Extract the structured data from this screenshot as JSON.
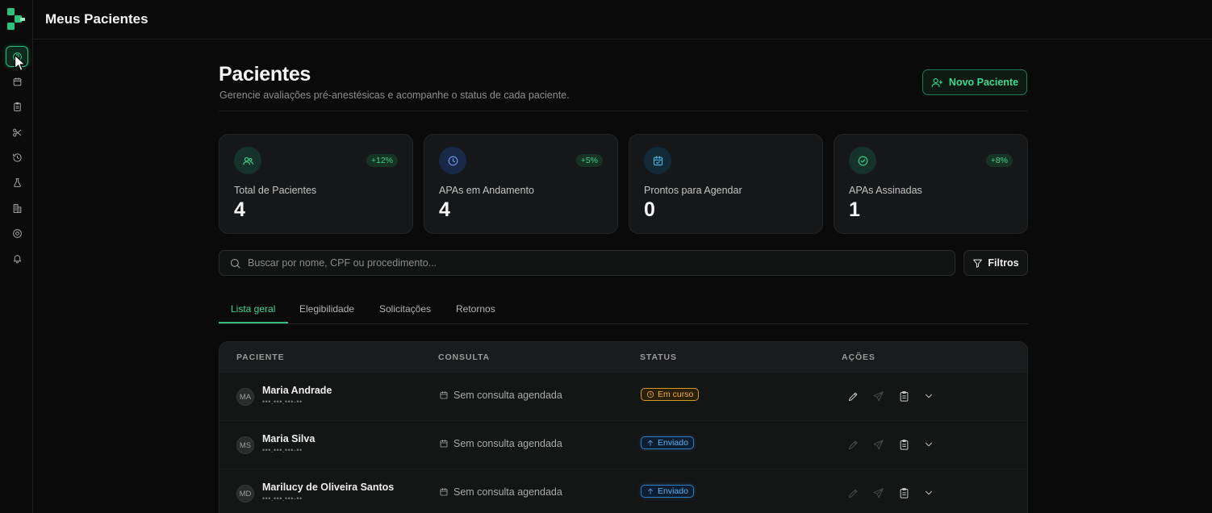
{
  "topbar": {
    "title": "Meus Pacientes"
  },
  "sidebar": {
    "items": [
      {
        "name": "patients",
        "icon": "user-circle-icon",
        "active": true
      },
      {
        "name": "calendar",
        "icon": "calendar-icon"
      },
      {
        "name": "clipboard",
        "icon": "clipboard-icon"
      },
      {
        "name": "procedures",
        "icon": "scissors-icon"
      },
      {
        "name": "history",
        "icon": "history-icon"
      },
      {
        "name": "lab",
        "icon": "flask-icon"
      },
      {
        "name": "buildings",
        "icon": "building-icon"
      },
      {
        "name": "profile",
        "icon": "at-sign-icon"
      },
      {
        "name": "notifications",
        "icon": "bell-icon"
      }
    ]
  },
  "header": {
    "title": "Pacientes",
    "subtitle": "Gerencie avaliações pré-anestésicas e acompanhe o status de cada paciente.",
    "new_button": "Novo Paciente"
  },
  "stats": [
    {
      "label": "Total de Pacientes",
      "value": "4",
      "badge": "+12%",
      "icon": "users-icon",
      "color": "#3fcf8a"
    },
    {
      "label": "APAs em Andamento",
      "value": "4",
      "badge": "+5%",
      "icon": "clock-icon",
      "color": "#5b8def"
    },
    {
      "label": "Prontos para Agendar",
      "value": "0",
      "badge": "",
      "icon": "calendar-check-icon",
      "color": "#4fb3e0"
    },
    {
      "label": "APAs Assinadas",
      "value": "1",
      "badge": "+8%",
      "icon": "check-circle-icon",
      "color": "#3fcf8a"
    }
  ],
  "search": {
    "placeholder": "Buscar por nome, CPF ou procedimento...",
    "value": ""
  },
  "filters_button": "Filtros",
  "tabs": [
    {
      "label": "Lista geral",
      "active": true
    },
    {
      "label": "Elegibilidade"
    },
    {
      "label": "Solicitações"
    },
    {
      "label": "Retornos"
    }
  ],
  "table": {
    "columns": [
      "PACIENTE",
      "CONSULTA",
      "STATUS",
      "AÇÕES"
    ],
    "rows": [
      {
        "initials": "MA",
        "name": "Maria Andrade",
        "doc": "•••.•••.•••-••",
        "consulta": "Sem consulta agendada",
        "status": "Em curso",
        "status_type": "curso",
        "edit_enabled": true
      },
      {
        "initials": "MS",
        "name": "Maria Silva",
        "doc": "•••.•••.•••-••",
        "consulta": "Sem consulta agendada",
        "status": "Enviado",
        "status_type": "enviado",
        "edit_enabled": false
      },
      {
        "initials": "MD",
        "name": "Marilucy de Oliveira Santos",
        "doc": "•••.•••.•••-••",
        "consulta": "Sem consulta agendada",
        "status": "Enviado",
        "status_type": "enviado",
        "edit_enabled": false
      }
    ]
  }
}
